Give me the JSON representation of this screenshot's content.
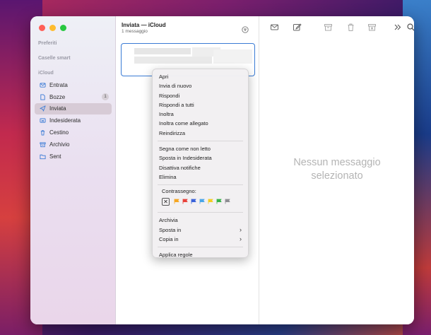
{
  "colors": {
    "accent": "#3a7bd5",
    "active_item": "#d7cbd6"
  },
  "sidebar": {
    "sections": {
      "favorites": "Preferiti",
      "smart": "Caselle smart",
      "account": "iCloud"
    },
    "items": [
      {
        "label": "Entrata",
        "icon": "envelope-icon",
        "badge": ""
      },
      {
        "label": "Bozze",
        "icon": "document-icon",
        "badge": "1"
      },
      {
        "label": "Inviata",
        "icon": "paper-plane-icon",
        "badge": ""
      },
      {
        "label": "Indesiderata",
        "icon": "junk-icon",
        "badge": ""
      },
      {
        "label": "Cestino",
        "icon": "trash-icon",
        "badge": ""
      },
      {
        "label": "Archivio",
        "icon": "archive-icon",
        "badge": ""
      },
      {
        "label": "Sent",
        "icon": "folder-icon",
        "badge": ""
      }
    ]
  },
  "list": {
    "title": "Inviata — iCloud",
    "subtitle": "1 messaggio"
  },
  "viewer": {
    "empty_line1": "Nessun messaggio",
    "empty_line2": "selezionato"
  },
  "toolbar": {
    "icons": [
      "get-mail-icon",
      "compose-icon",
      "archive-icon",
      "trash-icon",
      "junk-icon",
      "more-icon",
      "search-icon"
    ]
  },
  "menu": {
    "group1": [
      "Apri",
      "Invia di nuovo",
      "Rispondi",
      "Rispondi a tutti",
      "Inoltra",
      "Inoltra come allegato",
      "Reindirizza"
    ],
    "group2": [
      "Segna come non letto",
      "Sposta in Indesiderata",
      "Disattiva notifiche",
      "Elimina"
    ],
    "flag_label": "Contrassegno:",
    "flag_clear": "✕",
    "flag_colors": [
      "#f5a623",
      "#e8423b",
      "#3b62d9",
      "#4aa6e8",
      "#f3cd22",
      "#36b34a",
      "#8e8e93"
    ],
    "group3": [
      "Archivia",
      "Sposta in",
      "Copia in"
    ],
    "group4": [
      "Applica regole"
    ]
  }
}
